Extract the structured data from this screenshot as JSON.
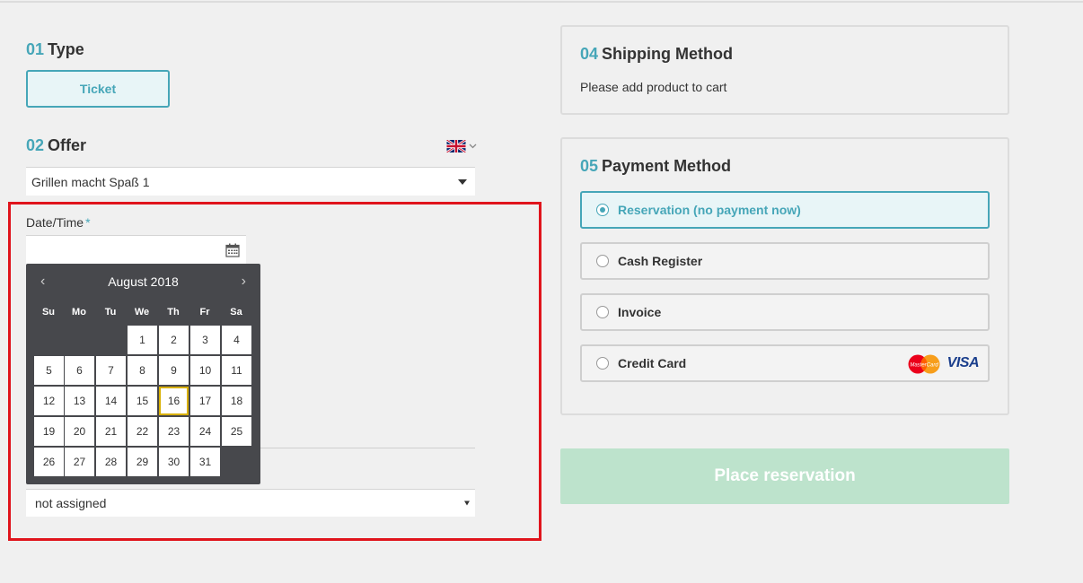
{
  "type_section": {
    "num": "01",
    "title": "Type",
    "ticket_label": "Ticket"
  },
  "offer_section": {
    "num": "02",
    "title": "Offer",
    "selected": "Grillen macht Spaß 1"
  },
  "datetime": {
    "label": "Date/Time",
    "required_mark": "*"
  },
  "calendar": {
    "prev": "‹",
    "next": "›",
    "month": "August 2018",
    "weekdays": [
      "Su",
      "Mo",
      "Tu",
      "We",
      "Th",
      "Fr",
      "Sa"
    ],
    "days": [
      "1",
      "2",
      "3",
      "4",
      "5",
      "6",
      "7",
      "8",
      "9",
      "10",
      "11",
      "12",
      "13",
      "14",
      "15",
      "16",
      "17",
      "18",
      "19",
      "20",
      "21",
      "22",
      "23",
      "24",
      "25",
      "26",
      "27",
      "28",
      "29",
      "30",
      "31"
    ],
    "today": "16"
  },
  "assign_select": {
    "selected": "not assigned"
  },
  "shipping": {
    "num": "04",
    "title": "Shipping Method",
    "text": "Please add product to cart"
  },
  "payment": {
    "num": "05",
    "title": "Payment Method",
    "options": [
      {
        "label": "Reservation (no payment now)"
      },
      {
        "label": "Cash Register"
      },
      {
        "label": "Invoice"
      },
      {
        "label": "Credit Card"
      }
    ],
    "selected_option": "Reservation (no payment now)",
    "mastercard_text": "MasterCard",
    "visa_text": "VISA"
  },
  "place_button": {
    "label": "Place reservation"
  },
  "colors": {
    "accent": "#46a6b8",
    "highlight": "#e0141c",
    "button_disabled": "#bde3cc",
    "calendar_bg": "#47484c",
    "today_border": "#d8b000"
  },
  "icons": {
    "language": "uk-flag-icon",
    "calendar": "calendar-icon"
  }
}
